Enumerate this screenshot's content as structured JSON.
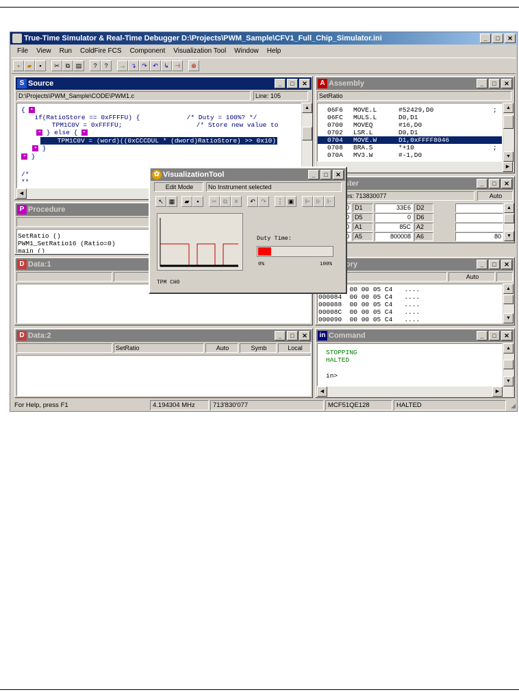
{
  "window": {
    "title": "True-Time Simulator & Real-Time Debugger   D:\\Projects\\PWM_Sample\\CFV1_Full_Chip_Simulator.ini"
  },
  "title_buttons": {
    "minimize": "_",
    "maximize": "□",
    "close": "✕"
  },
  "menu": [
    "File",
    "View",
    "Run",
    "ColdFire FCS",
    "Component",
    "Visualization Tool",
    "Window",
    "Help"
  ],
  "toolbar_icons": [
    "new-icon",
    "open-icon",
    "save-icon",
    "cut-icon",
    "copy-icon",
    "paste-icon",
    "help-icon",
    "context-help-icon",
    "start-icon",
    "single-step-icon",
    "step-over-icon",
    "step-out-icon",
    "assembly-step-icon",
    "halt-icon",
    "reset-icon"
  ],
  "source": {
    "title": "Source",
    "path": "D:\\Projects\\PWM_Sample\\CODE\\PWM1.c",
    "line_info": "Line: 105",
    "lines": [
      "{",
      "  if(RatioStore == 0xFFFFU) {            /* Duty = 100%? */",
      "    TPM1C0V = 0xFFFFU;                   /* Store new value to",
      "  } else {",
      "    TPM1C0V = (word)((0xCCCDUL * (dword)RatioStore) >> 0x10)",
      "  }",
      "}",
      "",
      "/*",
      "**"
    ]
  },
  "assembly": {
    "title": "Assembly",
    "function": "SetRatio",
    "rows": [
      {
        "addr": "06F6",
        "op": "MOVE.L",
        "args": "#52429,D0",
        "cmt": ";"
      },
      {
        "addr": "06FC",
        "op": "MULS.L",
        "args": "D0,D1",
        "cmt": ""
      },
      {
        "addr": "0700",
        "op": "MOVEQ",
        "args": "#16,D0",
        "cmt": ""
      },
      {
        "addr": "0702",
        "op": "LSR.L",
        "args": "D0,D1",
        "cmt": ""
      },
      {
        "addr": "0704",
        "op": "MOVE.W",
        "args": "D1,0xFFFF8046",
        "cmt": ""
      },
      {
        "addr": "0708",
        "op": "BRA.S",
        "args": "*+10",
        "cmt": ";"
      },
      {
        "addr": "070A",
        "op": "MV3.W",
        "args": "#-1,D0",
        "cmt": ""
      }
    ]
  },
  "register": {
    "title": "Register",
    "cpu_cycles": "CPU Cycles: 713830077",
    "mode": "Auto",
    "rows": [
      [
        "10",
        "D1",
        "33E6",
        "D2"
      ],
      [
        "0",
        "D5",
        "0",
        "D6"
      ],
      [
        "0",
        "A1",
        "85C",
        "A2"
      ],
      [
        "0",
        "A5",
        "800008",
        "A6"
      ]
    ],
    "tail": "80"
  },
  "procedure": {
    "title": "Procedure",
    "items": [
      "SetRatio ()",
      "PWM1_SetRatio16 (Ratio=0)",
      "main ()"
    ]
  },
  "data1": {
    "title": "Data:1"
  },
  "memory": {
    "title": "Memory",
    "mode": "Auto",
    "rows": [
      "000080  00 00 05 C4   ....",
      "000084  00 00 05 C4   ....",
      "000088  00 00 05 C4   ....",
      "00008C  00 00 05 C4   ....",
      "000090  00 00 05 C4   ...."
    ]
  },
  "data2": {
    "title": "Data:2",
    "cols": [
      "",
      "SetRatio",
      "Auto",
      "Symb",
      "Local"
    ]
  },
  "command": {
    "title": "Command",
    "lines": [
      "STOPPING",
      "HALTED",
      "",
      "in>"
    ]
  },
  "viz": {
    "title": "VisualizationTool",
    "edit_mode": "Edit Mode",
    "instrument": "No Instrument selected",
    "duty_label": "Duty Time:",
    "bar_min": "0%",
    "bar_max": "100%",
    "duty_fraction": 0.18,
    "channel": "TPM CH0"
  },
  "status": {
    "help": "For Help, press F1",
    "freq": "4.194304 MHz",
    "cycles": "713'830'077",
    "cpu": "MCF51QE128",
    "state": "HALTED"
  },
  "colors": {
    "selection": "#0a246a",
    "code_text": "#000080",
    "command_text": "#008000",
    "bar_fill": "#ff0000",
    "signal": "#c00000"
  }
}
